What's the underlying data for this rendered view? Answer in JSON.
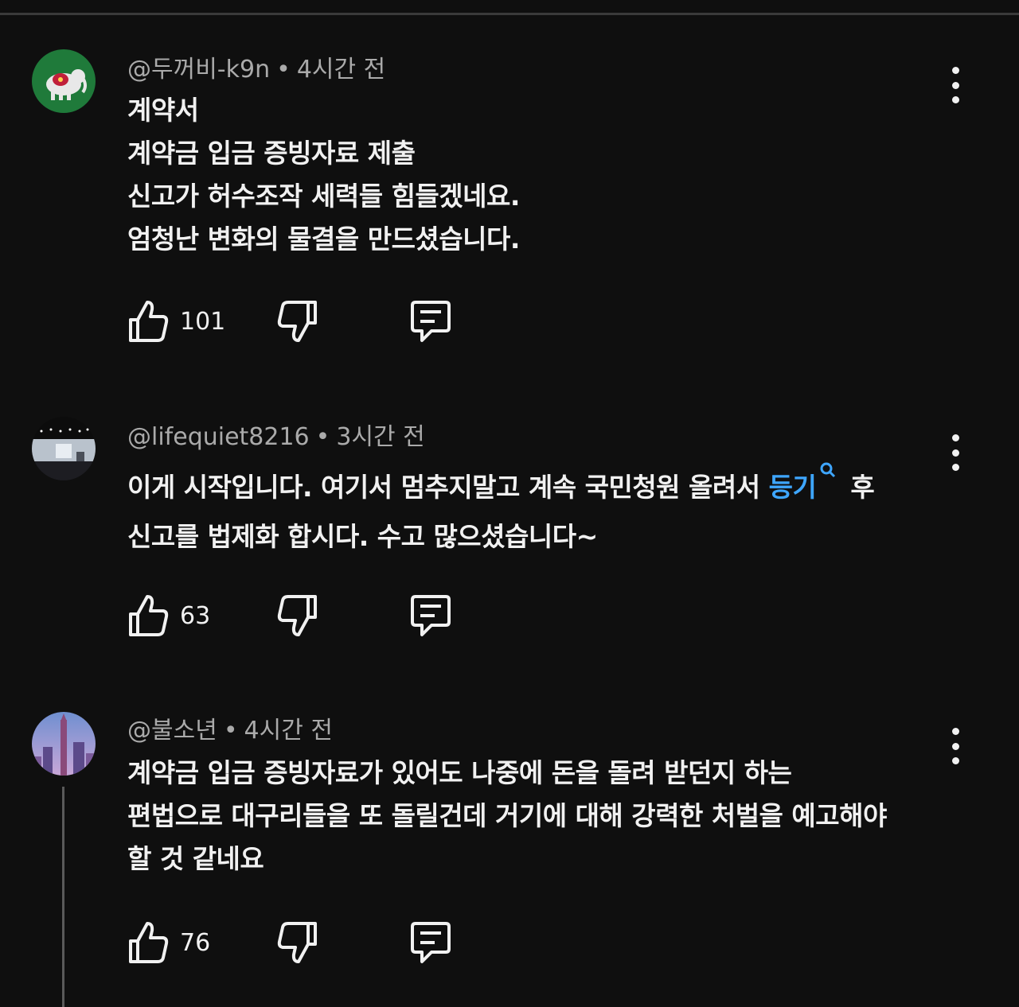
{
  "comments": [
    {
      "author": "@두꺼비-k9n",
      "separator": "•",
      "time": "4시간 전",
      "lines": [
        "계약서",
        "계약금 입금 증빙자료 제출",
        "신고가 허수조작 세력들 힘들겠네요.",
        "엄청난 변화의 물결을 만드셨습니다."
      ],
      "likes": "101",
      "avatar_icon": "elephant-avatar",
      "avatar_color": "#1f7a3a"
    },
    {
      "author": "@lifequiet8216",
      "separator": "•",
      "time": "3시간 전",
      "line1_before": "이게 시작입니다. 여기서 멈추지말고 계속 국민청원 올려서 ",
      "line1_link": "등기",
      "line1_after": " 후",
      "line2": "신고를 법제화 합시다. 수고 많으셨습니다~",
      "likes": "63",
      "avatar_icon": "stage-photo-avatar",
      "link_color": "#3ea6ff"
    },
    {
      "author": "@불소년",
      "separator": "•",
      "time": "4시간 전",
      "lines": [
        "계약금 입금 증빙자료가 있어도 나중에 돈을 돌려 받던지 하는",
        "편법으로 대구리들을 또 돌릴건데 거기에 대해 강력한 처벌을 예고해야",
        "할 것 같네요"
      ],
      "likes": "76",
      "avatar_icon": "city-tower-avatar"
    }
  ],
  "icons": {
    "like": "thumbs-up-icon",
    "dislike": "thumbs-down-icon",
    "reply": "reply-icon",
    "menu": "more-vert-icon",
    "search": "search-icon"
  }
}
